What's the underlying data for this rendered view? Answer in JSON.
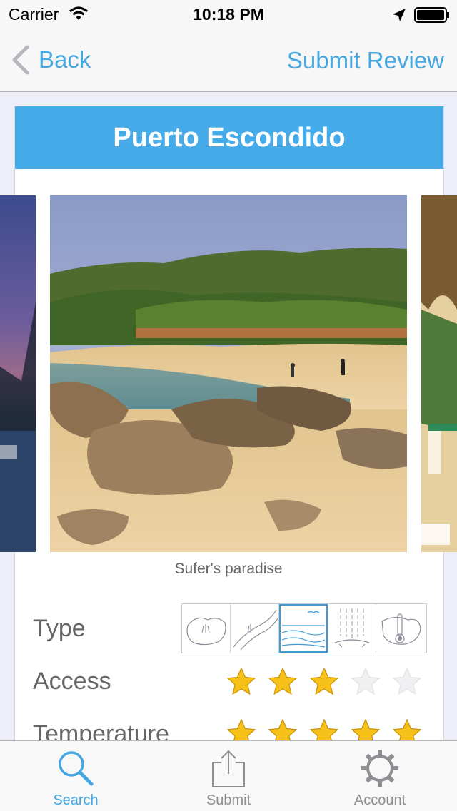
{
  "status_bar": {
    "carrier": "Carrier",
    "time": "10:18 PM"
  },
  "nav": {
    "back_label": "Back",
    "submit_label": "Submit Review"
  },
  "place": {
    "title": "Puerto Escondido",
    "caption": "Sufer's paradise"
  },
  "ratings": {
    "type_label": "Type",
    "type_icons": [
      "lake-icon",
      "river-icon",
      "sea-icon",
      "waterfall-icon",
      "hot-spring-icon"
    ],
    "type_selected_index": 2,
    "access_label": "Access",
    "access_stars": 3,
    "temperature_label": "Temperature",
    "temperature_stars": 5,
    "max_stars": 5
  },
  "tabs": [
    {
      "label": "Search",
      "icon": "search-icon",
      "active": true
    },
    {
      "label": "Submit",
      "icon": "share-icon",
      "active": false
    },
    {
      "label": "Account",
      "icon": "gear-icon",
      "active": false
    }
  ],
  "colors": {
    "accent": "#45a8e3",
    "header_bg": "#45ace9",
    "star_gold": "#f6c21a"
  }
}
